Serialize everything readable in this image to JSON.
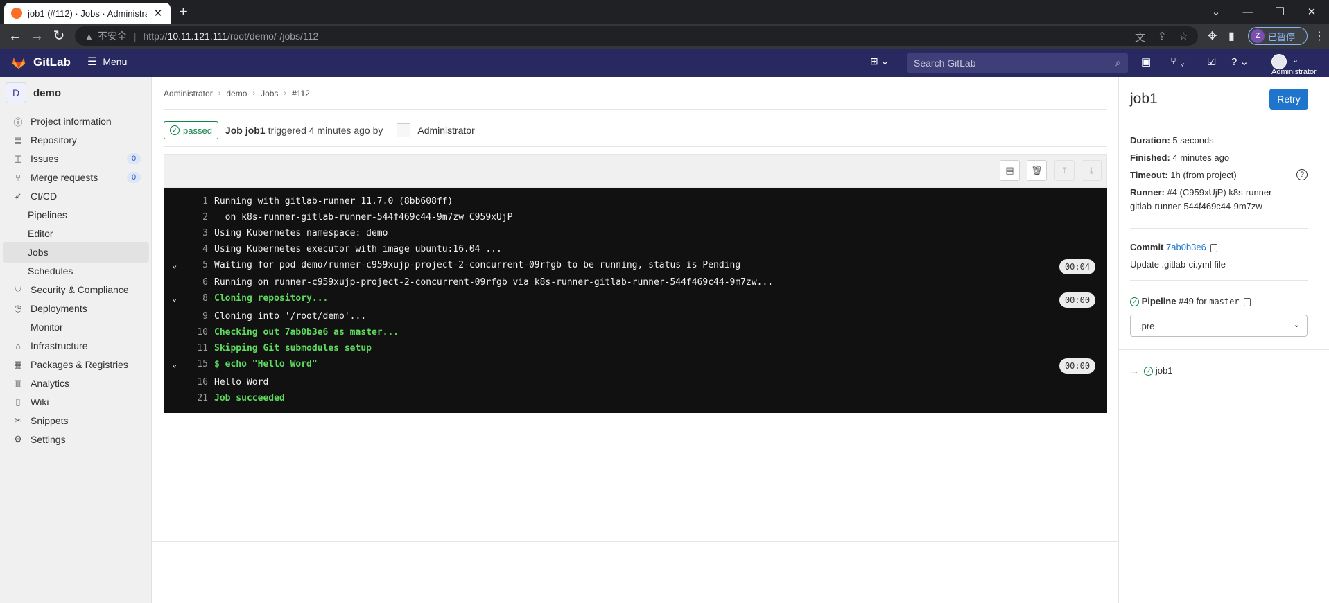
{
  "browser": {
    "tab_title": "job1 (#112) · Jobs · Administra",
    "insecure_label": "不安全",
    "url_prefix": "http://",
    "url_host": "10.11.121.111",
    "url_path": "/root/demo/-/jobs/112",
    "profile_initial": "Z",
    "profile_label": "已暂停"
  },
  "header": {
    "brand": "GitLab",
    "menu_label": "Menu",
    "search_placeholder": "Search GitLab",
    "user_name": "Administrator"
  },
  "sidebar": {
    "project_letter": "D",
    "project_name": "demo",
    "items": [
      {
        "label": "Project information",
        "icon": "info-icon"
      },
      {
        "label": "Repository",
        "icon": "book-icon"
      },
      {
        "label": "Issues",
        "icon": "issues-icon",
        "badge": "0"
      },
      {
        "label": "Merge requests",
        "icon": "merge-request-icon",
        "badge": "0"
      },
      {
        "label": "CI/CD",
        "icon": "rocket-icon"
      },
      {
        "label": "Pipelines"
      },
      {
        "label": "Editor"
      },
      {
        "label": "Jobs"
      },
      {
        "label": "Schedules"
      },
      {
        "label": "Security & Compliance",
        "icon": "shield-icon"
      },
      {
        "label": "Deployments",
        "icon": "deployments-icon"
      },
      {
        "label": "Monitor",
        "icon": "monitor-icon"
      },
      {
        "label": "Infrastructure",
        "icon": "infrastructure-icon"
      },
      {
        "label": "Packages & Registries",
        "icon": "package-icon"
      },
      {
        "label": "Analytics",
        "icon": "chart-icon"
      },
      {
        "label": "Wiki",
        "icon": "book-icon"
      },
      {
        "label": "Snippets",
        "icon": "scissors-icon"
      },
      {
        "label": "Settings",
        "icon": "gear-icon"
      }
    ]
  },
  "breadcrumb": [
    "Administrator",
    "demo",
    "Jobs",
    "#112"
  ],
  "job": {
    "status": "passed",
    "prefix": "Job",
    "name": "job1",
    "triggered": "triggered 4 minutes ago by",
    "user": "Administrator"
  },
  "log": [
    {
      "n": "1",
      "text": "Running with gitlab-runner 11.7.0 (8bb608ff)",
      "green": false
    },
    {
      "n": "2",
      "text": "  on k8s-runner-gitlab-runner-544f469c44-9m7zw C959xUjP",
      "green": false
    },
    {
      "n": "3",
      "text": "Using Kubernetes namespace: demo",
      "green": false
    },
    {
      "n": "4",
      "text": "Using Kubernetes executor with image ubuntu:16.04 ...",
      "green": false
    },
    {
      "n": "5",
      "text": "Waiting for pod demo/runner-c959xujp-project-2-concurrent-09rfgb to be running, status is Pending",
      "green": false,
      "section": true,
      "duration": "00:04"
    },
    {
      "n": "6",
      "text": "Running on runner-c959xujp-project-2-concurrent-09rfgb via k8s-runner-gitlab-runner-544f469c44-9m7zw...",
      "green": false
    },
    {
      "n": "8",
      "text": "Cloning repository...",
      "green": true,
      "section": true,
      "duration": "00:00"
    },
    {
      "n": "9",
      "text": "Cloning into '/root/demo'...",
      "green": false
    },
    {
      "n": "10",
      "text": "Checking out 7ab0b3e6 as master...",
      "green": true
    },
    {
      "n": "11",
      "text": "Skipping Git submodules setup",
      "green": true
    },
    {
      "n": "15",
      "text": "$ echo \"Hello Word\"",
      "green": true,
      "section": true,
      "duration": "00:00"
    },
    {
      "n": "16",
      "text": "Hello Word",
      "green": false
    },
    {
      "n": "21",
      "text": "Job succeeded",
      "green": true
    }
  ],
  "right": {
    "title": "job1",
    "retry": "Retry",
    "duration_label": "Duration:",
    "duration": "5 seconds",
    "finished_label": "Finished:",
    "finished": "4 minutes ago",
    "timeout_label": "Timeout:",
    "timeout": "1h (from project)",
    "runner_label": "Runner:",
    "runner_line1": "#4 (C959xUjP) k8s-runner-",
    "runner_line2": "gitlab-runner-544f469c44-9m7zw",
    "commit_label": "Commit",
    "commit_sha": "7ab0b3e6",
    "commit_msg": "Update .gitlab-ci.yml file",
    "pipeline_label": "Pipeline",
    "pipeline_id": "#49",
    "pipeline_for": "for",
    "pipeline_ref": "master",
    "stage": ".pre",
    "job_link": "job1"
  },
  "colors": {
    "header": "#292961",
    "accent": "#1f75cb",
    "success": "#108548"
  }
}
